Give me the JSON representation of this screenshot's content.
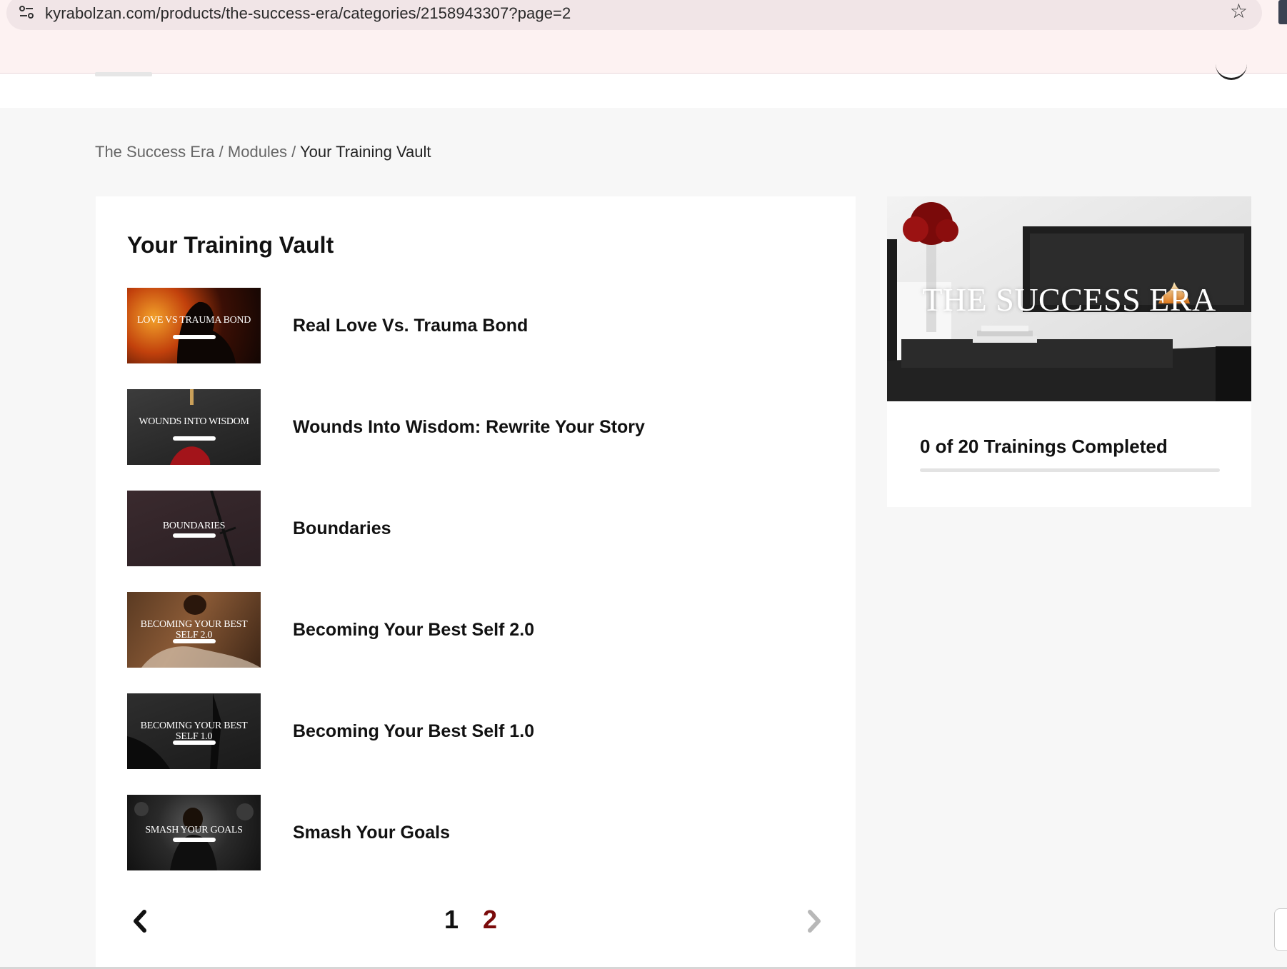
{
  "browser": {
    "url": "kyrabolzan.com/products/the-success-era/categories/2158943307?page=2",
    "icons": {
      "site_info": "tune-icon",
      "bookmark": "star-outline-icon"
    }
  },
  "breadcrumb": {
    "items": [
      "The Success Era",
      "Modules",
      "Your Training Vault"
    ],
    "separator": "/"
  },
  "main": {
    "title": "Your Training Vault",
    "trainings": [
      {
        "title": "Real Love Vs. Trauma Bond",
        "thumb_text": "LOVE VS TRAUMA BOND"
      },
      {
        "title": "Wounds Into Wisdom: Rewrite Your Story",
        "thumb_text": "WOUNDS INTO WISDOM"
      },
      {
        "title": "Boundaries",
        "thumb_text": "BOUNDARIES"
      },
      {
        "title": "Becoming Your Best Self 2.0",
        "thumb_text": "BECOMING YOUR BEST SELF 2.0"
      },
      {
        "title": "Becoming Your Best Self 1.0",
        "thumb_text": "BECOMING YOUR BEST SELF 1.0"
      },
      {
        "title": "Smash Your Goals",
        "thumb_text": "SMASH YOUR GOALS"
      }
    ]
  },
  "pagination": {
    "pages": [
      "1",
      "2"
    ],
    "current_page": "2",
    "icons": {
      "prev": "chevron-left-icon",
      "next": "chevron-right-icon"
    }
  },
  "sidebar": {
    "hero_title": "THE SUCCESS ERA",
    "progress_text": "0 of 20 Trainings Completed",
    "progress_fraction": 0
  },
  "colors": {
    "accent": "#7a0a0a",
    "page_bg": "#f7f7f7",
    "chrome_bg": "#fdf2f2"
  }
}
